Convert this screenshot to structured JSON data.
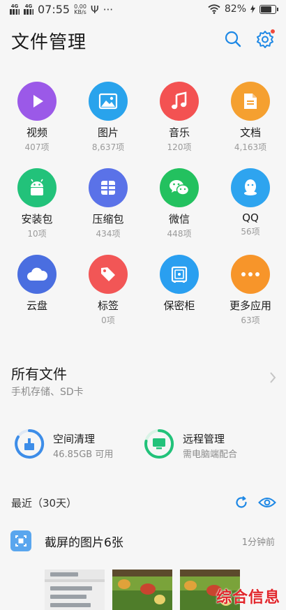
{
  "status_bar": {
    "signal1": "4G",
    "signal2": "4G",
    "time": "07:55",
    "speed_value": "0.00",
    "speed_unit": "KB/s",
    "usb_glyph": "Ψ",
    "more_glyph": "···",
    "battery_text": "82%",
    "battery_level": 82
  },
  "header": {
    "title": "文件管理",
    "search_icon": "search-icon",
    "settings_icon": "gear-icon",
    "accent": "#1e88e5",
    "badge_color": "#f04a3e"
  },
  "categories": [
    {
      "label": "视频",
      "count": "407项",
      "color": "#9b59e8",
      "icon": "play-icon"
    },
    {
      "label": "图片",
      "count": "8,637项",
      "color": "#29a3ec",
      "icon": "image-icon"
    },
    {
      "label": "音乐",
      "count": "120项",
      "color": "#f35252",
      "icon": "music-note-icon"
    },
    {
      "label": "文档",
      "count": "4,163项",
      "color": "#f5a030",
      "icon": "document-icon"
    },
    {
      "label": "安装包",
      "count": "10项",
      "color": "#22c27a",
      "icon": "android-icon"
    },
    {
      "label": "压缩包",
      "count": "434项",
      "color": "#5a72e8",
      "icon": "archive-icon"
    },
    {
      "label": "微信",
      "count": "448项",
      "color": "#23c15f",
      "icon": "wechat-icon"
    },
    {
      "label": "QQ",
      "count": "56项",
      "color": "#2ea4ef",
      "icon": "qq-icon"
    },
    {
      "label": "云盘",
      "count": "",
      "color": "#4a6ee0",
      "icon": "cloud-icon"
    },
    {
      "label": "标签",
      "count": "0项",
      "color": "#f25656",
      "icon": "tag-icon"
    },
    {
      "label": "保密柜",
      "count": "",
      "color": "#2a9ff0",
      "icon": "safe-icon"
    },
    {
      "label": "更多应用",
      "count": "63项",
      "color": "#f7952a",
      "icon": "more-apps-icon"
    }
  ],
  "all_files": {
    "title": "所有文件",
    "subtitle": "手机存储、SD卡"
  },
  "tools": {
    "cleanup": {
      "title": "空间清理",
      "subtitle": "46.85GB 可用"
    },
    "remote": {
      "title": "远程管理",
      "subtitle": "需电脑端配合"
    }
  },
  "recent": {
    "label": "最近（30天）",
    "refresh_icon": "refresh-icon",
    "eye_icon": "eye-icon"
  },
  "recent_group": {
    "title": "截屏的图片6张",
    "time": "1分钟前"
  },
  "watermark": "综合信息"
}
